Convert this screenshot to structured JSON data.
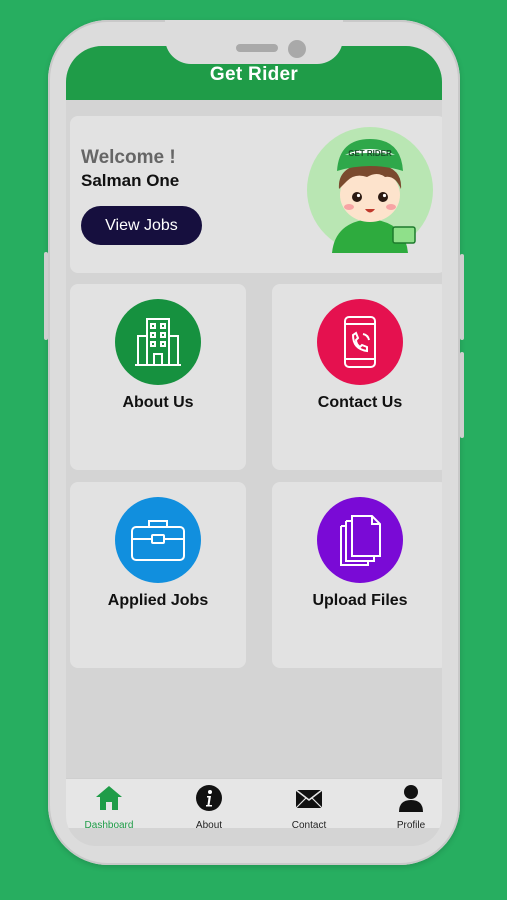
{
  "header": {
    "title": "Get Rider"
  },
  "welcome": {
    "greeting": "Welcome !",
    "name": "Salman One",
    "button_label": "View Jobs",
    "avatar_cap_text": "GET RIDER"
  },
  "tiles": [
    {
      "label": "About Us",
      "icon": "building-icon",
      "color": "#16913f"
    },
    {
      "label": "Contact Us",
      "icon": "phone-icon",
      "color": "#e5114f"
    },
    {
      "label": "Applied Jobs",
      "icon": "briefcase-icon",
      "color": "#118fde"
    },
    {
      "label": "Upload Files",
      "icon": "files-icon",
      "color": "#7a0ad6"
    }
  ],
  "bottom_nav": [
    {
      "label": "Dashboard",
      "icon": "home-icon",
      "active": true
    },
    {
      "label": "About",
      "icon": "info-icon",
      "active": false
    },
    {
      "label": "Contact",
      "icon": "mail-icon",
      "active": false
    },
    {
      "label": "Profile",
      "icon": "user-icon",
      "active": false
    }
  ],
  "colors": {
    "brand_green": "#1f9c48",
    "background": "#27ae60",
    "button_dark": "#160f3e"
  }
}
